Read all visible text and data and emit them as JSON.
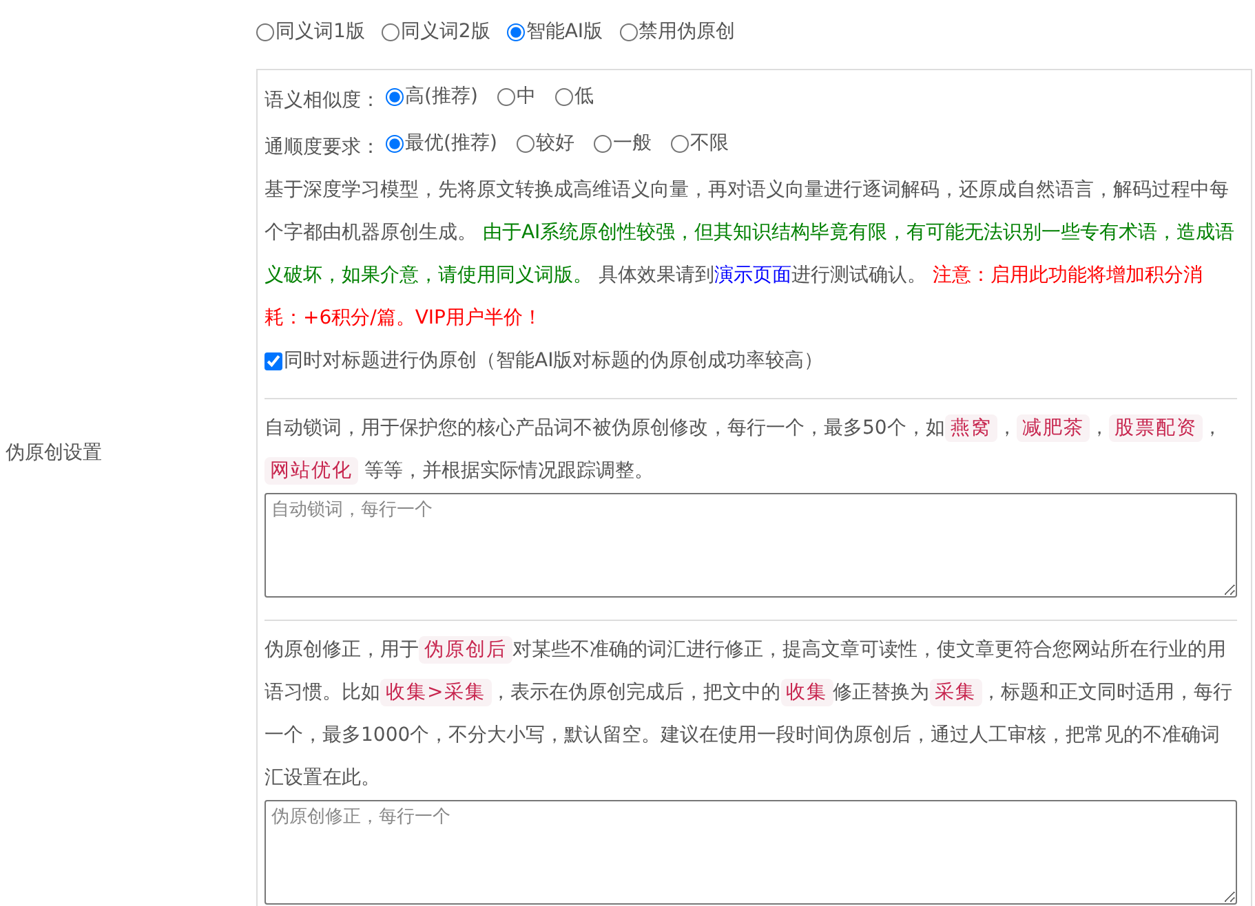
{
  "section_label": "伪原创设置",
  "modes": [
    {
      "label": "同义词1版",
      "selected": false
    },
    {
      "label": "同义词2版",
      "selected": false
    },
    {
      "label": "智能AI版",
      "selected": true
    },
    {
      "label": "禁用伪原创",
      "selected": false
    }
  ],
  "ai_options": {
    "similarity": {
      "label": "语义相似度：",
      "options": [
        {
          "label": "高(推荐)",
          "selected": true
        },
        {
          "label": "中",
          "selected": false
        },
        {
          "label": "低",
          "selected": false
        }
      ]
    },
    "fluency": {
      "label": "通顺度要求：",
      "options": [
        {
          "label": "最优(推荐)",
          "selected": true
        },
        {
          "label": "较好",
          "selected": false
        },
        {
          "label": "一般",
          "selected": false
        },
        {
          "label": "不限",
          "selected": false
        }
      ]
    },
    "description": [
      {
        "kind": "text",
        "text": "基于深度学习模型，先将原文转换成高维语义向量，再对语义向量进行逐词解码，还原成自然语言，解码过程中每个字都由机器原创生成。 "
      },
      {
        "kind": "green",
        "text": "由于AI系统原创性较强，但其知识结构毕竟有限，有可能无法识别一些专有术语，造成语义破坏，如果介意，请使用同义词版。"
      },
      {
        "kind": "text",
        "text": " 具体效果请到"
      },
      {
        "kind": "link",
        "text": "演示页面"
      },
      {
        "kind": "text",
        "text": "进行测试确认。 "
      },
      {
        "kind": "red",
        "text": "注意：启用此功能将增加积分消耗：+6积分/篇。VIP用户半价！"
      }
    ],
    "title_option": {
      "label": "同时对标题进行伪原创（智能AI版对标题的伪原创成功率较高）",
      "checked": true
    }
  },
  "lock_words": {
    "description": [
      {
        "kind": "text",
        "text": "自动锁词，用于保护您的核心产品词不被伪原创修改，每行一个，最多50个，如"
      },
      {
        "kind": "code",
        "text": "燕窝"
      },
      {
        "kind": "text",
        "text": "，"
      },
      {
        "kind": "code",
        "text": "减肥茶"
      },
      {
        "kind": "text",
        "text": "，"
      },
      {
        "kind": "code",
        "text": "股票配资"
      },
      {
        "kind": "text",
        "text": "，"
      },
      {
        "kind": "code",
        "text": "网站优化"
      },
      {
        "kind": "text",
        "text": " 等等，并根据实际情况跟踪调整。"
      }
    ],
    "placeholder": "自动锁词，每行一个"
  },
  "correction": {
    "description": [
      {
        "kind": "text",
        "text": "伪原创修正，用于"
      },
      {
        "kind": "code",
        "text": "伪原创后"
      },
      {
        "kind": "text",
        "text": "对某些不准确的词汇进行修正，提高文章可读性，使文章更符合您网站所在行业的用语习惯。比如"
      },
      {
        "kind": "code",
        "text": "收集>采集"
      },
      {
        "kind": "text",
        "text": "，表示在伪原创完成后，把文中的"
      },
      {
        "kind": "code",
        "text": "收集"
      },
      {
        "kind": "text",
        "text": "修正替换为"
      },
      {
        "kind": "code",
        "text": "采集"
      },
      {
        "kind": "text",
        "text": "，标题和正文同时适用，每行一个，最多1000个，不分大小写，默认留空。建议在使用一段时间伪原创后，通过人工审核，把常见的不准确词汇设置在此。"
      }
    ],
    "placeholder": "伪原创修正，每行一个"
  }
}
